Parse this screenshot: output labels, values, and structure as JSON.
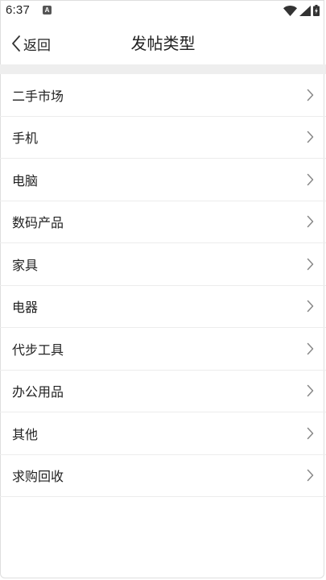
{
  "status_bar": {
    "time": "6:37",
    "notification_icon": "A",
    "icons": [
      "wifi-icon",
      "signal-icon",
      "battery-icon"
    ]
  },
  "header": {
    "back_label": "返回",
    "title": "发帖类型"
  },
  "categories": [
    {
      "label": "二手市场"
    },
    {
      "label": "手机"
    },
    {
      "label": "电脑"
    },
    {
      "label": "数码产品"
    },
    {
      "label": "家具"
    },
    {
      "label": "电器"
    },
    {
      "label": "代步工具"
    },
    {
      "label": "办公用品"
    },
    {
      "label": "其他"
    },
    {
      "label": "求购回收"
    }
  ],
  "colors": {
    "text": "#222222",
    "divider": "#ececec",
    "band": "#eeeeee",
    "chevron": "#888888"
  }
}
